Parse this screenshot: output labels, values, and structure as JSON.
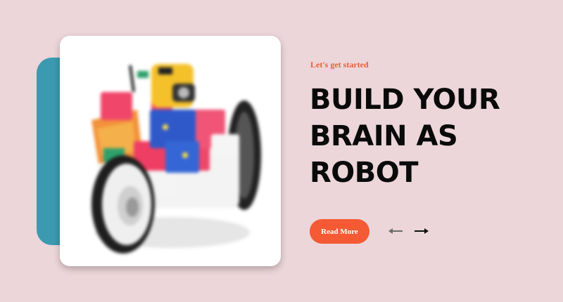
{
  "hero": {
    "eyebrow": "Let's get started",
    "title": "BUILD YOUR BRAIN AS ROBOT",
    "cta_label": "Read More"
  },
  "image": {
    "subject": "toy robot car built from colorful blocks"
  },
  "carousel": {
    "prev_icon": "arrow-left-icon",
    "next_icon": "arrow-right-icon"
  },
  "colors": {
    "background": "#ecd6d9",
    "accent": "#f45a33",
    "card_back": "#3c9ab0",
    "title": "#0a0a0a"
  }
}
